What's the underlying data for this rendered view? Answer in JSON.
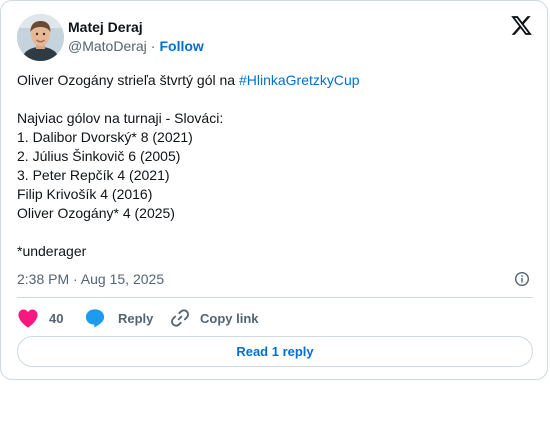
{
  "author": {
    "name": "Matej Deraj",
    "handle": "@MatoDeraj",
    "separator": "·",
    "follow_label": "Follow"
  },
  "tweet": {
    "line1_text": "Oliver Ozogány strieľa štvrtý gól na ",
    "hashtag": "#HlinkaGretzkyCup",
    "heading": "Najviac gólov na turnaji - Slováci:",
    "scorers": [
      "1. Dalibor Dvorský* 8 (2021)",
      "2. Július Šinkovič 6 (2005)",
      "3. Peter Repčík 4 (2021)",
      "Filip Krivošík 4 (2016)",
      "Oliver Ozogány* 4 (2025)"
    ],
    "footnote": "*underager",
    "timestamp": "2:38 PM · Aug 15, 2025"
  },
  "actions": {
    "like_count": "40",
    "reply_label": "Reply",
    "copy_label": "Copy link",
    "read_replies_label": "Read 1 reply"
  },
  "colors": {
    "accent": "#006fd6",
    "like": "#f91880",
    "reply_icon": "#1d9bf0",
    "muted": "#536471",
    "border": "#cfd9de"
  },
  "icons": {
    "logo": "x-logo-icon",
    "info": "info-icon",
    "like": "heart-icon",
    "reply": "speech-bubble-icon",
    "copy": "link-icon"
  }
}
